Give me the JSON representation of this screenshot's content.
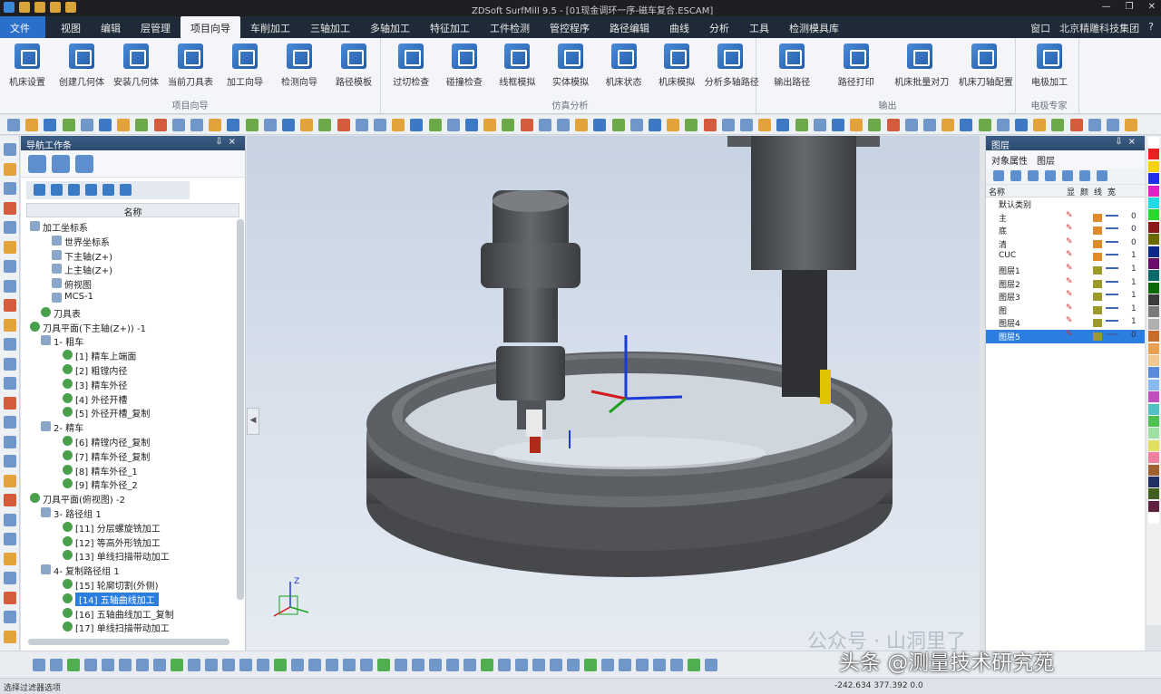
{
  "window": {
    "title": "ZDSoft SurfMill 9.5 - [01现金调环一序-磁车复合.ESCAM]",
    "controls": [
      "—",
      "❐",
      "✕"
    ]
  },
  "menu": {
    "items": [
      "文件",
      "视图",
      "编辑",
      "层管理",
      "项目向导",
      "车削加工",
      "三轴加工",
      "多轴加工",
      "特征加工",
      "工件检测",
      "管控程序",
      "路径编辑",
      "曲线",
      "分析",
      "工具",
      "检测模具库"
    ],
    "active_index": 4,
    "right": [
      "窗口",
      "北京精雕科技集团",
      "?"
    ]
  },
  "ribbon": {
    "groups": [
      {
        "label": "项目向导",
        "buttons": [
          "机床设置",
          "创建几何体",
          "安装几何体",
          "当前刀具表",
          "加工向导",
          "检测向导",
          "路径模板"
        ]
      },
      {
        "label": "仿真分析",
        "buttons": [
          "过切检查",
          "碰撞检查",
          "线框模拟",
          "实体模拟",
          "机床状态",
          "机床模拟",
          "分析多轴路径"
        ]
      },
      {
        "label": "输出",
        "buttons": [
          "输出路径",
          "路径打印",
          "机床批量对刀",
          "机床刀轴配置"
        ]
      },
      {
        "label": "电极专家",
        "buttons": [
          "电极加工"
        ]
      }
    ]
  },
  "left_panel": {
    "title": "导航工作条",
    "column": "名称",
    "tree": [
      {
        "text": "加工坐标系",
        "indent": 0,
        "icon": "sq"
      },
      {
        "text": "世界坐标系",
        "indent": 2,
        "icon": "sq"
      },
      {
        "text": "下主轴(Z+)",
        "indent": 2,
        "icon": "sq"
      },
      {
        "text": "上主轴(Z+)",
        "indent": 2,
        "icon": "sq"
      },
      {
        "text": "俯视图",
        "indent": 2,
        "icon": "sq"
      },
      {
        "text": "MCS-1",
        "indent": 2,
        "icon": "sq"
      },
      {
        "text": "刀具表",
        "indent": 1,
        "icon": "g"
      },
      {
        "text": "刀具平面(下主轴(Z+)) -1",
        "indent": 0,
        "icon": "g"
      },
      {
        "text": "1- 粗车",
        "indent": 1,
        "icon": "sq"
      },
      {
        "text": "[1] 精车上端面",
        "indent": 3,
        "icon": "g"
      },
      {
        "text": "[2] 粗镗内径",
        "indent": 3,
        "icon": "g"
      },
      {
        "text": "[3] 精车外径",
        "indent": 3,
        "icon": "g"
      },
      {
        "text": "[4] 外径开槽",
        "indent": 3,
        "icon": "g"
      },
      {
        "text": "[5] 外径开槽_复制",
        "indent": 3,
        "icon": "g"
      },
      {
        "text": "2- 精车",
        "indent": 1,
        "icon": "sq"
      },
      {
        "text": "[6] 精镗内径_复制",
        "indent": 3,
        "icon": "g"
      },
      {
        "text": "[7] 精车外径_复制",
        "indent": 3,
        "icon": "g"
      },
      {
        "text": "[8] 精车外径_1",
        "indent": 3,
        "icon": "g"
      },
      {
        "text": "[9] 精车外径_2",
        "indent": 3,
        "icon": "g"
      },
      {
        "text": "刀具平面(俯视图) -2",
        "indent": 0,
        "icon": "g"
      },
      {
        "text": "3- 路径组 1",
        "indent": 1,
        "icon": "sq"
      },
      {
        "text": "[11] 分层螺旋铣加工",
        "indent": 3,
        "icon": "g"
      },
      {
        "text": "[12] 等高外形铣加工",
        "indent": 3,
        "icon": "g"
      },
      {
        "text": "[13] 单线扫描带动加工",
        "indent": 3,
        "icon": "g"
      },
      {
        "text": "4- 复制路径组 1",
        "indent": 1,
        "icon": "sq"
      },
      {
        "text": "[15] 轮廓切割(外侧)",
        "indent": 3,
        "icon": "g"
      },
      {
        "text": "[14] 五轴曲线加工",
        "indent": 3,
        "icon": "g",
        "selected": true
      },
      {
        "text": "[16] 五轴曲线加工_复制",
        "indent": 3,
        "icon": "g"
      },
      {
        "text": "[17] 单线扫描带动加工",
        "indent": 3,
        "icon": "g"
      }
    ]
  },
  "right_panel": {
    "title": "图层",
    "tabs": [
      "对象属性",
      "图层"
    ],
    "header": [
      "名称",
      "显",
      "颜",
      "线",
      "宽"
    ],
    "layers": [
      {
        "name": "默认类别",
        "color": "",
        "width": ""
      },
      {
        "name": "主",
        "color": "#e08a2a",
        "width": "0"
      },
      {
        "name": "底",
        "color": "#e08a2a",
        "width": "0"
      },
      {
        "name": "清",
        "color": "#e08a2a",
        "width": "0"
      },
      {
        "name": "CUC",
        "color": "#e08a2a",
        "width": "1"
      },
      {
        "name": "图层1",
        "color": "#9c9b2a",
        "width": "1"
      },
      {
        "name": "图层2",
        "color": "#9c9b2a",
        "width": "1"
      },
      {
        "name": "图层3",
        "color": "#9c9b2a",
        "width": "1"
      },
      {
        "name": "图",
        "color": "#9c9b2a",
        "width": "1"
      },
      {
        "name": "图层4",
        "color": "#9c9b2a",
        "width": "1"
      },
      {
        "name": "图层5",
        "color": "#9c9b2a",
        "width": "0",
        "selected": true
      }
    ]
  },
  "palette": [
    "#ffffff",
    "#e82020",
    "#f5d20a",
    "#1e30e8",
    "#e020c8",
    "#22d8e0",
    "#2ad82a",
    "#8a1a1a",
    "#6a6a00",
    "#0a2a8a",
    "#6a0a6a",
    "#0a6a6a",
    "#0a6a0a",
    "#3a3a3a",
    "#7a7a7a",
    "#b0b0b0",
    "#c86a2a",
    "#e8a050",
    "#f0c890",
    "#5a8ad8",
    "#8ab8f0",
    "#c050c0",
    "#50c0c0",
    "#50c050",
    "#a0e0a0",
    "#e0e060",
    "#f080a0",
    "#a06030",
    "#203060",
    "#406020",
    "#602040",
    "#ffffff"
  ],
  "viewport": {
    "watermark_faint": "公众号 · 山洞里了",
    "axis_label": "Z"
  },
  "statusbar": {
    "text": "选择过滤器选项",
    "coords": "-242.634 377.392 0.0"
  },
  "watermark": {
    "text": "头条 @测量技术研究苑"
  }
}
